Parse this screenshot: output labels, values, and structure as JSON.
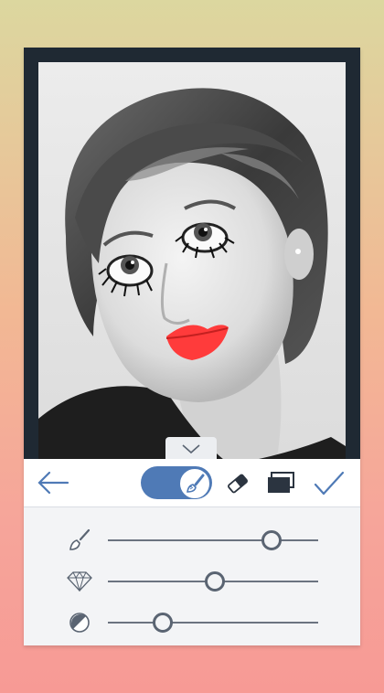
{
  "colors": {
    "accent": "#4f7ab6",
    "frame": "#1f2933",
    "lips": "#ff3b3b",
    "toolbar_bg": "#ffffff",
    "panel_bg": "#f3f4f6"
  },
  "toolbar": {
    "back_icon": "arrow-left-icon",
    "mode_toggle": {
      "on": true,
      "icon": "paintbrush-icon"
    },
    "eraser_icon": "eraser-icon",
    "layers_icon": "layers-icon",
    "confirm_icon": "checkmark-icon"
  },
  "collapse_tab": {
    "icon": "chevron-down-icon"
  },
  "sliders": [
    {
      "icon": "brush-size-icon",
      "value": 0.78
    },
    {
      "icon": "diamond-hardness-icon",
      "value": 0.51
    },
    {
      "icon": "contrast-opacity-icon",
      "value": 0.26
    }
  ]
}
